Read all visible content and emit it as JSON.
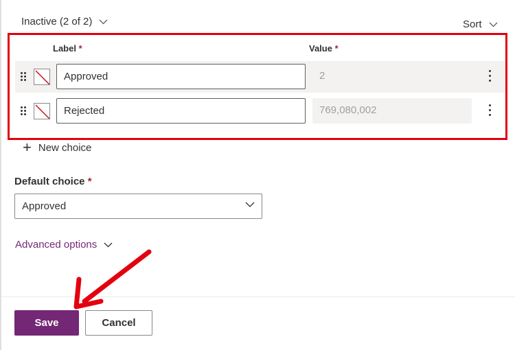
{
  "section": {
    "title": "Inactive (2 of 2)",
    "sort_label": "Sort"
  },
  "columns": {
    "label": "Label",
    "value": "Value",
    "required_mark": "*"
  },
  "choices": [
    {
      "label": "Approved",
      "value": "2",
      "color_icon": "no-color-swatch"
    },
    {
      "label": "Rejected",
      "value": "769,080,002",
      "color_icon": "no-color-swatch"
    }
  ],
  "new_choice_label": "New choice",
  "default_choice": {
    "label": "Default choice",
    "required_mark": "*",
    "selected": "Approved"
  },
  "advanced_options_label": "Advanced options",
  "footer": {
    "save_label": "Save",
    "cancel_label": "Cancel"
  },
  "colors": {
    "accent": "#742774",
    "highlight_frame": "#e3000f",
    "annotation_arrow": "#e3000f",
    "required": "#a4262c"
  },
  "icons": [
    "chevron-down-icon",
    "drag-handle-icon",
    "more-vertical-icon",
    "plus-icon",
    "no-color-swatch-icon"
  ]
}
